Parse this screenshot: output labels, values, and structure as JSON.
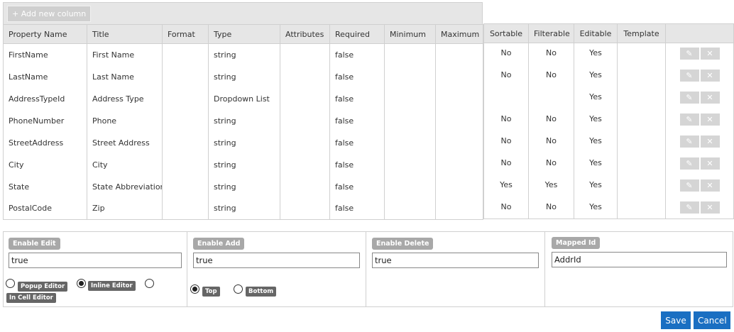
{
  "toolbar": {
    "add_column_label": "Add new column",
    "add_icon": "+"
  },
  "left_table": {
    "headers": [
      "Property Name",
      "Title",
      "Format",
      "Type",
      "Attributes",
      "Required",
      "Minimum",
      "Maximum"
    ],
    "rows": [
      [
        "FirstName",
        "First Name",
        "",
        "string",
        "",
        "false",
        "",
        ""
      ],
      [
        "LastName",
        "Last Name",
        "",
        "string",
        "",
        "false",
        "",
        ""
      ],
      [
        "AddressTypeId",
        "Address Type",
        "",
        "Dropdown List",
        "",
        "false",
        "",
        ""
      ],
      [
        "PhoneNumber",
        "Phone",
        "",
        "string",
        "",
        "false",
        "",
        ""
      ],
      [
        "StreetAddress",
        "Street Address",
        "",
        "string",
        "",
        "false",
        "",
        ""
      ],
      [
        "City",
        "City",
        "",
        "string",
        "",
        "false",
        "",
        ""
      ],
      [
        "State",
        "State Abbreviation",
        "",
        "string",
        "",
        "false",
        "",
        ""
      ],
      [
        "PostalCode",
        "Zip",
        "",
        "string",
        "",
        "false",
        "",
        ""
      ]
    ]
  },
  "right_table": {
    "headers": [
      "Sortable",
      "Filterable",
      "Editable",
      "Template",
      ""
    ],
    "rows": [
      [
        "No",
        "No",
        "Yes",
        ""
      ],
      [
        "No",
        "No",
        "Yes",
        ""
      ],
      [
        "",
        "",
        "Yes",
        ""
      ],
      [
        "No",
        "No",
        "Yes",
        ""
      ],
      [
        "No",
        "No",
        "Yes",
        ""
      ],
      [
        "No",
        "No",
        "Yes",
        ""
      ],
      [
        "Yes",
        "Yes",
        "Yes",
        ""
      ],
      [
        "No",
        "No",
        "Yes",
        ""
      ]
    ],
    "edit_icon": "✎",
    "delete_icon": "✕"
  },
  "settings": {
    "enable_edit": {
      "label": "Enable Edit",
      "value": "true",
      "options": [
        "Popup Editor",
        "Inline Editor",
        "In Cell Editor"
      ],
      "selected": "Inline Editor"
    },
    "enable_add": {
      "label": "Enable Add",
      "value": "true",
      "options": [
        "Top",
        "Bottom"
      ],
      "selected": "Top"
    },
    "enable_delete": {
      "label": "Enable Delete",
      "value": "true"
    },
    "mapped_id": {
      "label": "Mapped Id",
      "value": "AddrId"
    }
  },
  "footer": {
    "save_label": "Save",
    "cancel_label": "Cancel"
  }
}
